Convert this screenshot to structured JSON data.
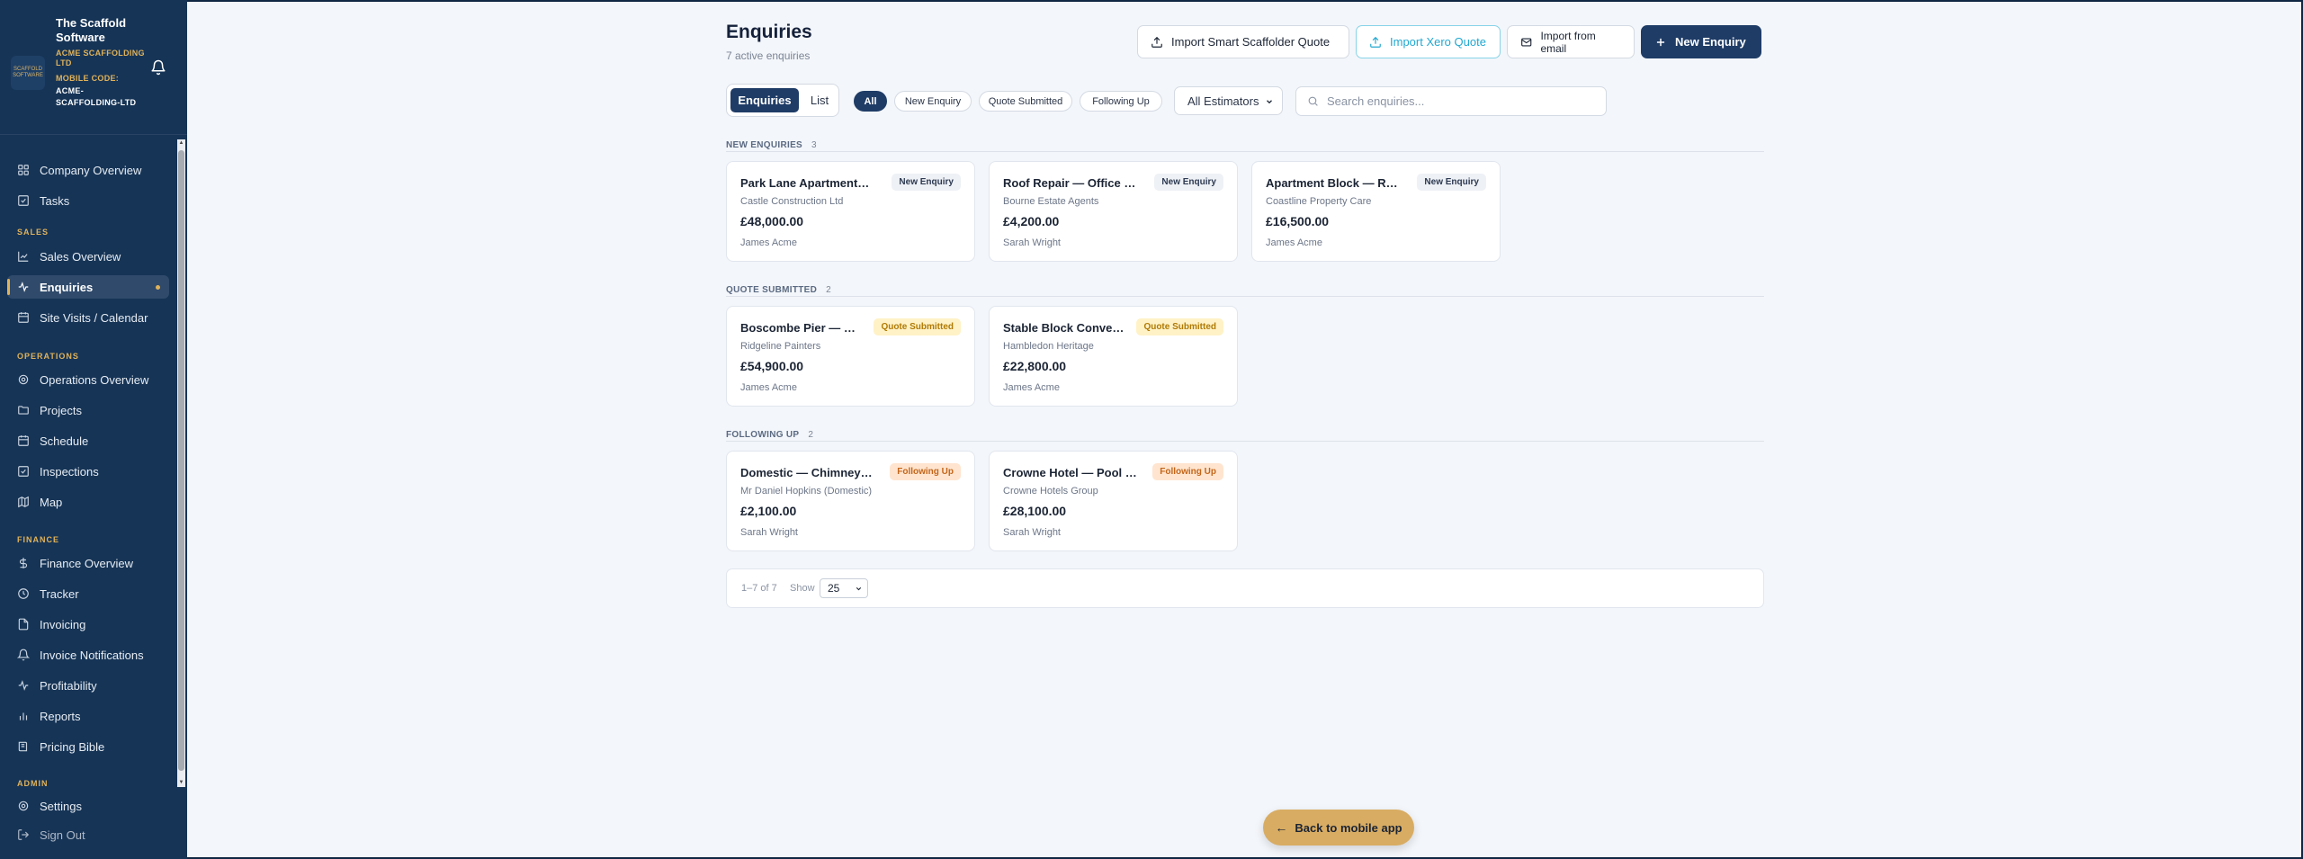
{
  "sidebar": {
    "brand_name": "The Scaffold Software",
    "logo_text": "SCAFFOLD SOFTWARE",
    "company": "ACME SCAFFOLDING LTD",
    "mobile_code_label": "MOBILE CODE:",
    "mobile_code": "ACME-SCAFFOLDING-LTD",
    "items": {
      "company_overview": "Company Overview",
      "tasks": "Tasks",
      "sales_label": "SALES",
      "sales_overview": "Sales Overview",
      "enquiries": "Enquiries",
      "site_visits": "Site Visits / Calendar",
      "operations_label": "OPERATIONS",
      "operations_overview": "Operations Overview",
      "projects": "Projects",
      "schedule": "Schedule",
      "inspections": "Inspections",
      "map": "Map",
      "finance_label": "FINANCE",
      "finance_overview": "Finance Overview",
      "tracker": "Tracker",
      "invoicing": "Invoicing",
      "invoice_notifications": "Invoice Notifications",
      "profitability": "Profitability",
      "reports": "Reports",
      "pricing_bible": "Pricing Bible",
      "admin_label": "ADMIN",
      "settings": "Settings",
      "sign_out": "Sign Out"
    }
  },
  "header": {
    "title": "Enquiries",
    "subtitle": "7 active enquiries",
    "buttons": {
      "import_smart": "Import Smart Scaffolder Quote",
      "import_xero": "Import Xero Quote",
      "import_email": "Import from email",
      "new_enquiry": "New Enquiry"
    }
  },
  "toolbar": {
    "view_enquiries": "Enquiries",
    "view_list": "List",
    "filters": {
      "all": "All",
      "new_enquiry": "New Enquiry",
      "quote_submitted": "Quote Submitted",
      "following_up": "Following Up"
    },
    "estimator": "All Estimators",
    "search_placeholder": "Search enquiries..."
  },
  "groups": {
    "new": {
      "label": "NEW ENQUIRIES",
      "count": "3",
      "cards": [
        {
          "title": "Park Lane Apartments — Full Scaffold",
          "badge": "New Enquiry",
          "client": "Castle Construction Ltd",
          "amount": "£48,000.00",
          "person": "James Acme"
        },
        {
          "title": "Roof Repair — Office Front",
          "badge": "New Enquiry",
          "client": "Bourne Estate Agents",
          "amount": "£4,200.00",
          "person": "Sarah Wright"
        },
        {
          "title": "Apartment Block — Repairs",
          "badge": "New Enquiry",
          "client": "Coastline Property Care",
          "amount": "£16,500.00",
          "person": "James Acme"
        }
      ]
    },
    "quote": {
      "label": "QUOTE SUBMITTED",
      "count": "2",
      "cards": [
        {
          "title": "Boscombe Pier — Repaint",
          "badge": "Quote Submitted",
          "client": "Ridgeline Painters",
          "amount": "£54,900.00",
          "person": "James Acme"
        },
        {
          "title": "Stable Block Conversion",
          "badge": "Quote Submitted",
          "client": "Hambledon Heritage",
          "amount": "£22,800.00",
          "person": "James Acme"
        }
      ]
    },
    "follow": {
      "label": "FOLLOWING UP",
      "count": "2",
      "cards": [
        {
          "title": "Domestic — Chimney + Roof",
          "badge": "Following Up",
          "client": "Mr Daniel Hopkins (Domestic)",
          "amount": "£2,100.00",
          "person": "Sarah Wright"
        },
        {
          "title": "Crowne Hotel — Pool Roof",
          "badge": "Following Up",
          "client": "Crowne Hotels Group",
          "amount": "£28,100.00",
          "person": "Sarah Wright"
        }
      ]
    }
  },
  "pagination": {
    "range": "1–7 of 7",
    "show_label": "Show",
    "page_size": "25"
  },
  "back_button": "Back to mobile app",
  "colors": {
    "sidebar_bg": "#163456",
    "accent_gold": "#e0b25a",
    "primary_navy": "#1f3c66",
    "xero_blue": "#22a8d1"
  }
}
